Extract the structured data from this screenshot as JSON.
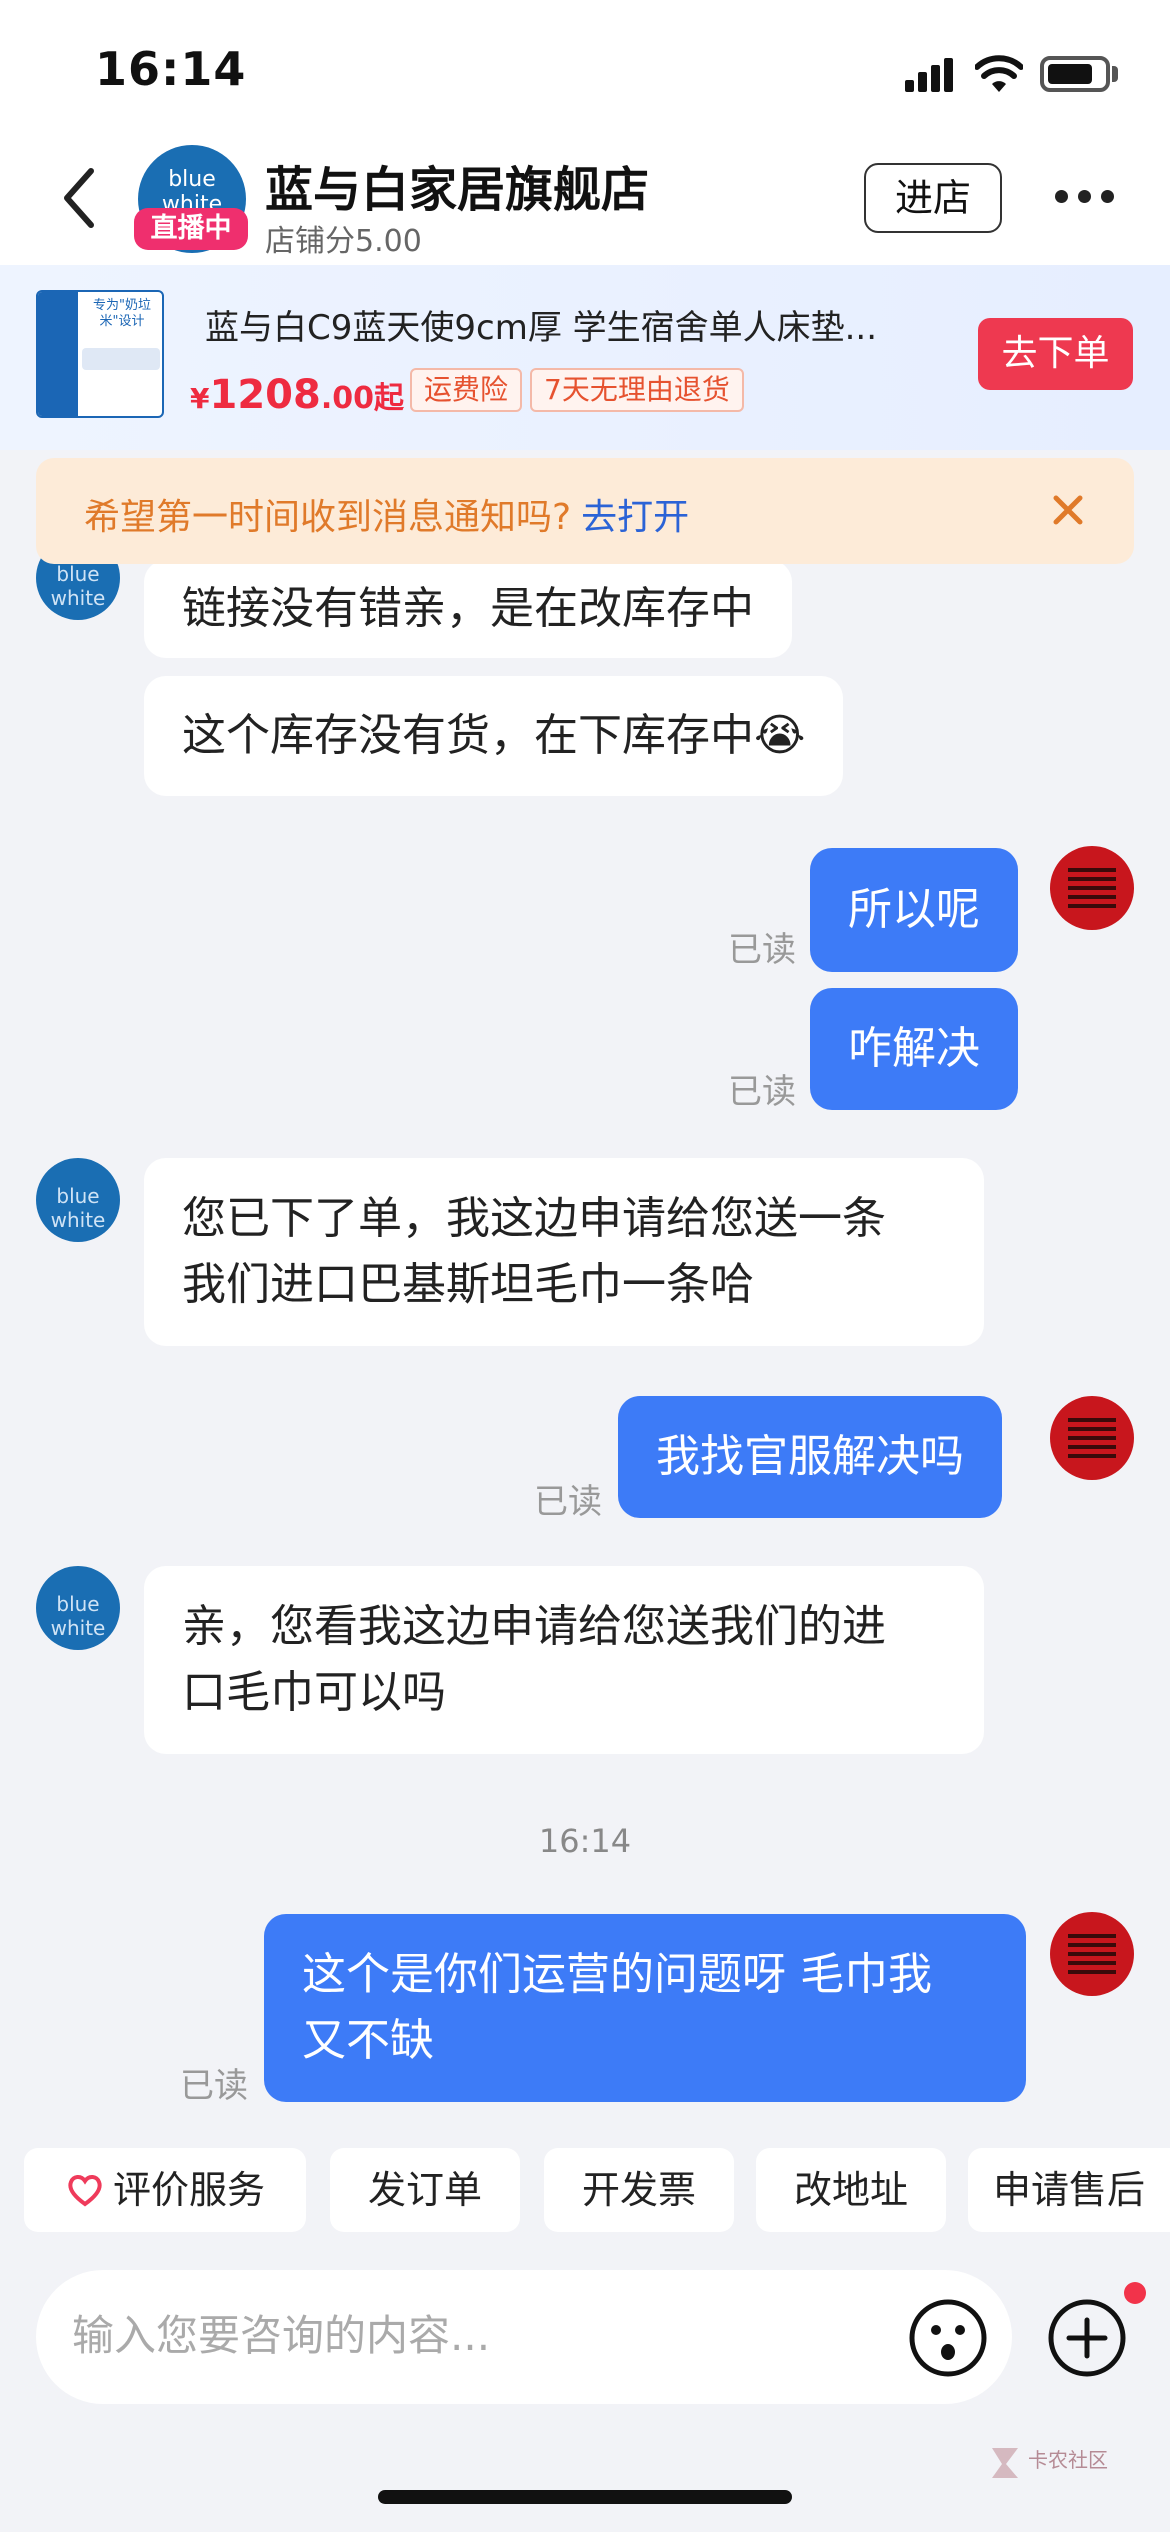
{
  "status_bar": {
    "time": "16:14"
  },
  "header": {
    "shop_name": "蓝与白家居旗舰店",
    "live_badge": "直播中",
    "shop_score": "店铺分5.00",
    "enter_store": "进店",
    "avatar_logo": "blue white"
  },
  "product": {
    "title": "蓝与白C9蓝天使9cm厚 学生宿舍单人床垫...",
    "price_currency": "¥",
    "price_int": "1208",
    "price_dec": ".00起",
    "tags": [
      "运费险",
      "7天无理由退货"
    ],
    "order_button": "去下单",
    "thumb_text": "专为\"奶垃米\"设计"
  },
  "notice": {
    "text": "希望第一时间收到消息通知吗?",
    "link": "去打开"
  },
  "messages": [
    {
      "side": "in",
      "text": "链接没有错亲，是在改库存中"
    },
    {
      "side": "in",
      "text": "这个库存没有货，在下库存中😭"
    },
    {
      "side": "out",
      "text": "所以呢",
      "read": "已读"
    },
    {
      "side": "out",
      "text": "咋解决",
      "read": "已读"
    },
    {
      "side": "in",
      "lines": [
        "您已下了单，我这边申请给您送一条",
        "我们进口巴基斯坦毛巾一条哈"
      ]
    },
    {
      "side": "out",
      "text": "我找官服解决吗",
      "read": "已读"
    },
    {
      "side": "in",
      "lines": [
        "亲，您看我这边申请给您送我们的进",
        "口毛巾可以吗"
      ]
    },
    {
      "side": "divider",
      "text": "16:14"
    },
    {
      "side": "out",
      "lines": [
        "这个是你们运营的问题呀 毛巾我",
        "又不缺"
      ],
      "read": "已读"
    }
  ],
  "quick_actions": [
    "评价服务",
    "发订单",
    "开发票",
    "改地址",
    "申请售后"
  ],
  "input": {
    "placeholder": "输入您要咨询的内容..."
  },
  "watermark": "卡农社区"
}
